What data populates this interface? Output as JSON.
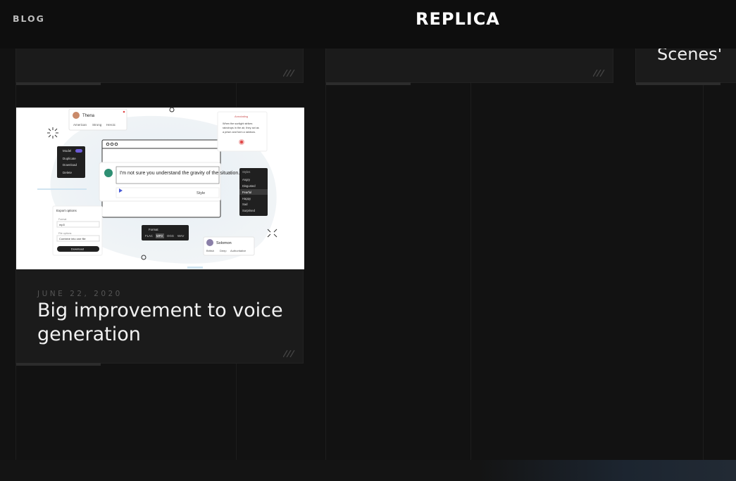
{
  "header": {
    "blog_label": "BLOG",
    "logo_text": "REPLICA"
  },
  "cards_top": [
    {
      "title": ""
    },
    {
      "title": ""
    },
    {
      "title": "Scenes'"
    }
  ],
  "featured_post": {
    "date": "JUNE 22, 2020",
    "title": "Big improvement to voice generation",
    "illustration": {
      "voice_card_1": {
        "name": "Thena",
        "tags": [
          "American",
          "Strong",
          "Heroic"
        ]
      },
      "voice_card_2": {
        "name": "Solomon",
        "tags": [
          "British",
          "Deep",
          "Authoritative"
        ]
      },
      "editor_text": "I'm not sure you understand the gravity of the situation. If we do no",
      "editor_style_label": "Style",
      "menu_items": [
        "Model",
        "Duplicate",
        "Download",
        "Delete"
      ],
      "styles_header": "Styles",
      "styles": [
        "Angry",
        "Disgusted",
        "Fearful",
        "Happy",
        "Sad",
        "Surprised"
      ],
      "format_header": "Format",
      "formats": [
        "FLAC",
        "MP3",
        "OGG",
        "WAV"
      ],
      "export_header": "Export options",
      "export_format_label": "Format",
      "export_format_value": "mp3",
      "export_file_label": "File options",
      "export_file_value": "Combine into one file",
      "export_button": "Download",
      "note_header": "Annotating",
      "note_text_1": "When the sunlight strikes",
      "note_text_2": "raindrops in the air, they act as",
      "note_text_3": "a prism and form a rainbow."
    }
  },
  "colors": {
    "background": "#121212",
    "card": "#1b1b1b",
    "accent_purple": "#6b5bd6"
  }
}
